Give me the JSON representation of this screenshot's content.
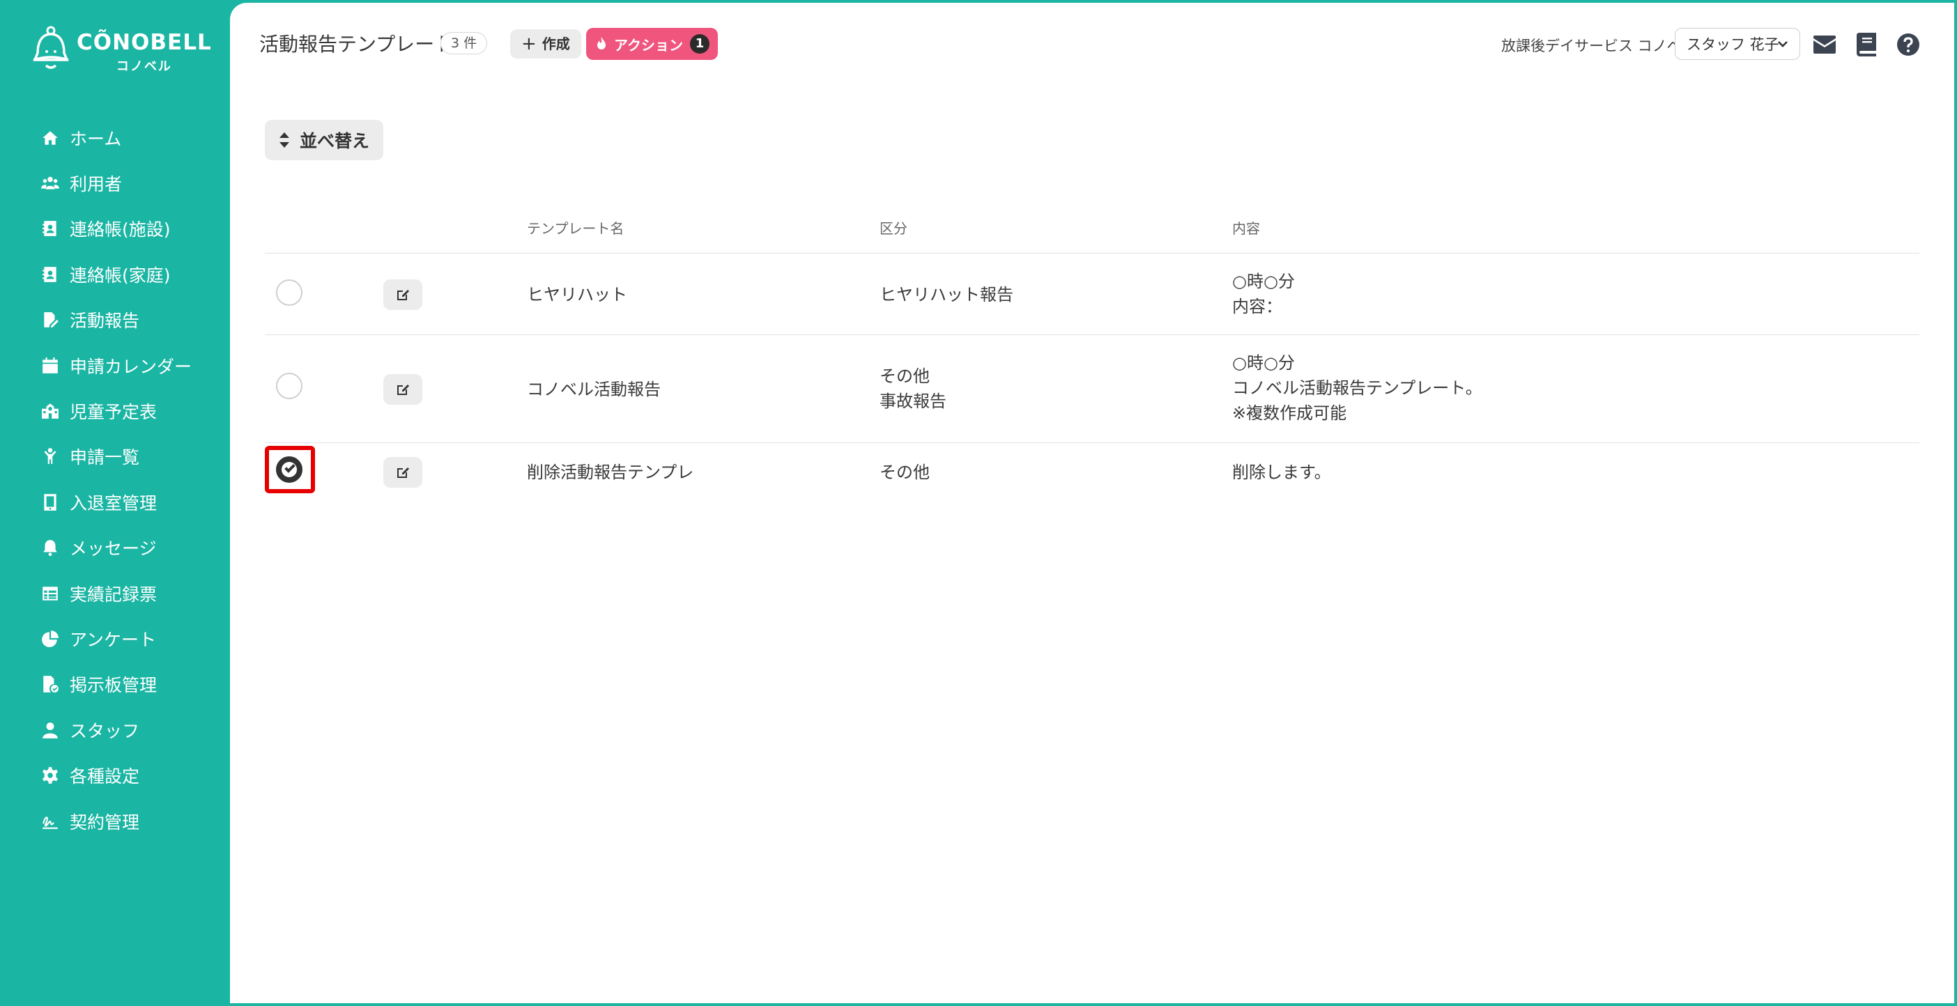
{
  "brand": {
    "name": "CÕNOBELL",
    "sub": "コノベル"
  },
  "sidebar": {
    "items": [
      {
        "label": "ホーム",
        "icon": "home-icon"
      },
      {
        "label": "利用者",
        "icon": "users-icon"
      },
      {
        "label": "連絡帳(施設)",
        "icon": "contact-book-icon"
      },
      {
        "label": "連絡帳(家庭)",
        "icon": "contact-book-icon"
      },
      {
        "label": "活動報告",
        "icon": "file-edit-icon"
      },
      {
        "label": "申請カレンダー",
        "icon": "calendar-icon"
      },
      {
        "label": "児童予定表",
        "icon": "school-icon"
      },
      {
        "label": "申請一覧",
        "icon": "child-icon"
      },
      {
        "label": "入退室管理",
        "icon": "tablet-icon"
      },
      {
        "label": "メッセージ",
        "icon": "bell-icon"
      },
      {
        "label": "実績記録票",
        "icon": "table-icon"
      },
      {
        "label": "アンケート",
        "icon": "pie-chart-icon"
      },
      {
        "label": "掲示板管理",
        "icon": "file-check-icon"
      },
      {
        "label": "スタッフ",
        "icon": "user-icon"
      },
      {
        "label": "各種設定",
        "icon": "gear-icon"
      },
      {
        "label": "契約管理",
        "icon": "signature-icon"
      }
    ]
  },
  "header": {
    "title": "活動報告テンプレート",
    "count": "3 件",
    "create_label": "作成",
    "action_label": "アクション",
    "action_count": "1",
    "facility": "放課後デイサービス コノベル",
    "staff": "スタッフ 花子"
  },
  "toolbar": {
    "sort_label": "並べ替え"
  },
  "table": {
    "columns": [
      "テンプレート名",
      "区分",
      "内容"
    ],
    "rows": [
      {
        "checked": false,
        "name": "ヒヤリハット",
        "category": [
          "ヒヤリハット報告"
        ],
        "content": [
          "○時○分",
          "内容："
        ]
      },
      {
        "checked": false,
        "name": "コノベル活動報告",
        "category": [
          "その他",
          "事故報告"
        ],
        "content": [
          "○時○分",
          "コノベル活動報告テンプレート。",
          "※複数作成可能"
        ]
      },
      {
        "checked": true,
        "name": "削除活動報告テンプレ",
        "category": [
          "その他"
        ],
        "content": [
          "削除します。"
        ]
      }
    ]
  },
  "colors": {
    "brand": "#1ab5a3",
    "action": "#f0557e",
    "highlight": "#e60000"
  }
}
